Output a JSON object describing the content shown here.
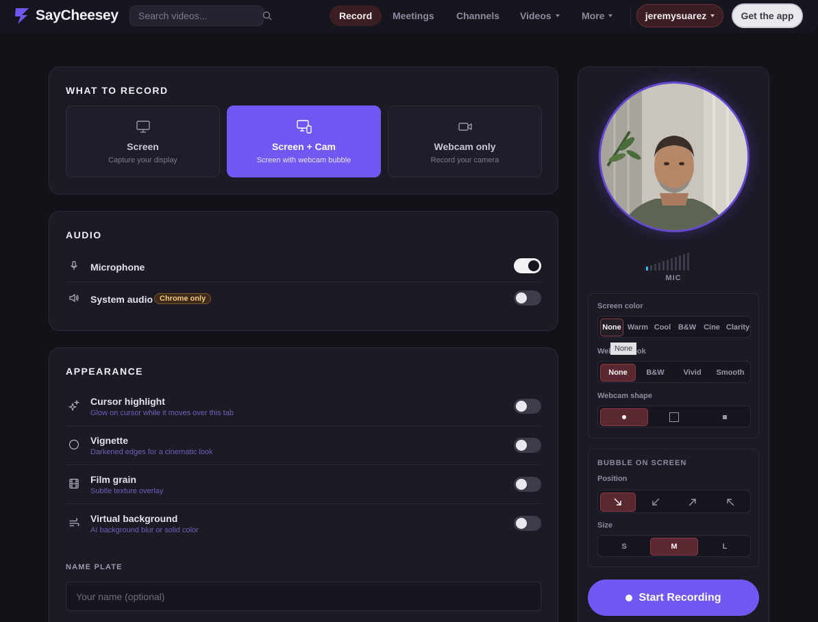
{
  "app": {
    "name": "SayCheesey"
  },
  "search": {
    "placeholder": "Search videos..."
  },
  "nav": {
    "items": [
      {
        "label": "Record",
        "active": true
      },
      {
        "label": "Meetings"
      },
      {
        "label": "Channels"
      },
      {
        "label": "Videos",
        "dropdown": true
      },
      {
        "label": "More",
        "dropdown": true
      }
    ],
    "user": "jeremysuarez",
    "get_app": "Get the app"
  },
  "record": {
    "title": "WHAT TO RECORD",
    "options": [
      {
        "title": "Screen",
        "subtitle": "Capture your display",
        "icon": "monitor-icon",
        "selected": false
      },
      {
        "title": "Screen + Cam",
        "subtitle": "Screen with webcam bubble",
        "icon": "screen-cam-icon",
        "selected": true
      },
      {
        "title": "Webcam only",
        "subtitle": "Record your camera",
        "icon": "video-camera-icon",
        "selected": false
      }
    ]
  },
  "audio": {
    "title": "AUDIO",
    "microphone": {
      "label": "Microphone",
      "on": true,
      "icon": "microphone-icon"
    },
    "system": {
      "label": "System audio",
      "badge": "Chrome only",
      "on": false,
      "icon": "speaker-icon"
    }
  },
  "appearance": {
    "title": "APPEARANCE",
    "items": [
      {
        "title": "Cursor highlight",
        "subtitle": "Glow on cursor while it moves over this tab",
        "on": false,
        "icon": "sparkles-icon"
      },
      {
        "title": "Vignette",
        "subtitle": "Darkened edges for a cinematic look",
        "on": false,
        "icon": "circle-icon"
      },
      {
        "title": "Film grain",
        "subtitle": "Subtle texture overlay",
        "on": false,
        "icon": "film-icon"
      },
      {
        "title": "Virtual background",
        "subtitle": "AI background blur or solid color",
        "on": false,
        "icon": "wind-icon"
      }
    ],
    "name_plate": {
      "label": "NAME PLATE",
      "placeholder": "Your name (optional)"
    }
  },
  "preview": {
    "mic_label": "MIC",
    "mic_level": 0.1,
    "screen_color": {
      "label": "Screen color",
      "options": [
        "None",
        "Warm",
        "Cool",
        "B&W",
        "Cine",
        "Clarity"
      ],
      "selected": "None"
    },
    "tooltip": "None",
    "webcam_look": {
      "label": "Webcam look",
      "options": [
        "None",
        "B&W",
        "Vivid",
        "Smooth"
      ],
      "selected": "None"
    },
    "webcam_shape": {
      "label": "Webcam shape",
      "options": [
        "circle",
        "square",
        "small-square"
      ],
      "selected": "circle"
    },
    "bubble": {
      "title": "BUBBLE ON SCREEN",
      "position_label": "Position",
      "positions": [
        "bottom-right",
        "bottom-left",
        "top-right",
        "top-left"
      ],
      "position_selected": "bottom-right",
      "size_label": "Size",
      "sizes": [
        "S",
        "M",
        "L"
      ],
      "size_selected": "M"
    },
    "start": "Start Recording"
  },
  "colors": {
    "accent": "#7257f2",
    "selected": "#5a2830",
    "background": "#121219"
  }
}
